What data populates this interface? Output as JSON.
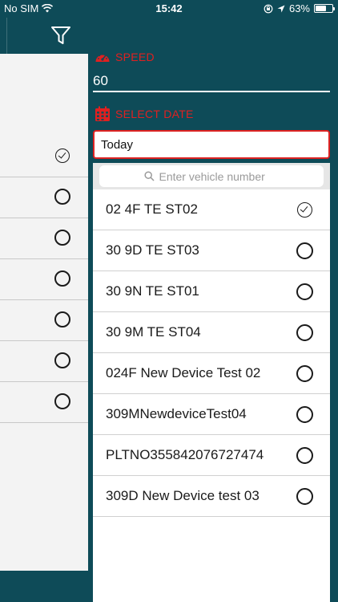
{
  "status_bar": {
    "carrier": "No SIM",
    "time": "15:42",
    "battery": "63%"
  },
  "drawer": {
    "speed_label": "SPEED",
    "speed_value": "60",
    "date_label": "SELECT DATE",
    "date_value": "Today",
    "search_placeholder": "Enter vehicle number",
    "vehicles": [
      {
        "name": "02 4F TE ST02",
        "selected": true
      },
      {
        "name": "30 9D TE ST03",
        "selected": false
      },
      {
        "name": "30 9N TE ST01",
        "selected": false
      },
      {
        "name": "30 9M TE ST04",
        "selected": false
      },
      {
        "name": "024F New Device Test 02",
        "selected": false
      },
      {
        "name": "309MNewdeviceTest04",
        "selected": false
      },
      {
        "name": "PLTNO355842076727474",
        "selected": false
      },
      {
        "name": "309D New Device test 03",
        "selected": false
      }
    ]
  },
  "colors": {
    "background": "#0e4b58",
    "accent_red": "#e02020"
  }
}
